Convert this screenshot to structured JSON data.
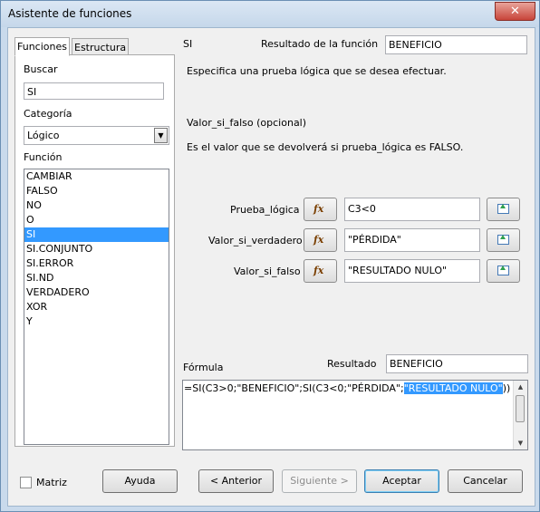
{
  "window": {
    "title": "Asistente de funciones",
    "close_label": "✕"
  },
  "tabs": [
    {
      "label": "Funciones"
    },
    {
      "label": "Estructura"
    }
  ],
  "search": {
    "label": "Buscar",
    "value": "SI"
  },
  "category": {
    "label": "Categoría",
    "value": "Lógico"
  },
  "function_list": {
    "label": "Función",
    "items": [
      "CAMBIAR",
      "FALSO",
      "NO",
      "O",
      "SI",
      "SI.CONJUNTO",
      "SI.ERROR",
      "SI.ND",
      "VERDADERO",
      "XOR",
      "Y"
    ],
    "selected": "SI"
  },
  "function_info": {
    "name": "SI",
    "result_label": "Resultado de la función",
    "result_value": "BENEFICIO",
    "description": "Especifica una prueba lógica que se desea efectuar.",
    "arg_title": "Valor_si_falso (opcional)",
    "arg_description": "Es el valor que se devolverá si prueba_lógica es FALSO."
  },
  "arguments": [
    {
      "label": "Prueba_lógica",
      "value": "C3<0"
    },
    {
      "label": "Valor_si_verdadero",
      "value": "\"PÉRDIDA\""
    },
    {
      "label": "Valor_si_falso",
      "value": "\"RESULTADO NULO\""
    }
  ],
  "formula": {
    "label": "Fórmula",
    "result_label": "Resultado",
    "result_value": "BENEFICIO",
    "text_before": "=SI(C3>0;\"BENEFICIO\";SI(C3<0;\"PÉRDIDA\";",
    "text_selected": "\"RESULTADO NULO\"",
    "text_after": "))"
  },
  "footer": {
    "matrix_label": "Matriz",
    "matrix_checked": false,
    "help_label": "Ayuda",
    "back_label": "< Anterior",
    "next_label": "Siguiente >",
    "ok_label": "Aceptar",
    "cancel_label": "Cancelar"
  },
  "colors": {
    "selection": "#3399ff",
    "title_bar": "#c9daec",
    "close_button": "#c8453a"
  }
}
